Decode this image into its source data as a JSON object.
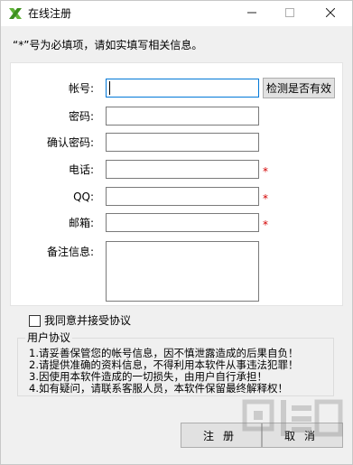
{
  "window": {
    "title": "在线注册",
    "app_icon": "x-logo-icon",
    "controls": [
      "minimize-icon",
      "maximize-icon",
      "close-icon"
    ]
  },
  "notice": "“*”号为必填项，请如实填写相关信息。",
  "form": {
    "account": {
      "label": "帐号:",
      "value": ""
    },
    "check_button": "检测是否有效",
    "password": {
      "label": "密码:",
      "value": ""
    },
    "confirm_password": {
      "label": "确认密码:",
      "value": ""
    },
    "phone": {
      "label": "电话:",
      "value": "",
      "required_mark": "*"
    },
    "qq": {
      "label": "QQ:",
      "value": "",
      "required_mark": "*"
    },
    "email": {
      "label": "邮箱:",
      "value": "",
      "required_mark": "*"
    },
    "remark": {
      "label": "备注信息:",
      "value": ""
    }
  },
  "agree": {
    "label": "我同意并接受协议",
    "checked": false
  },
  "agreement": {
    "title": "用户协议",
    "items": [
      "1.请妥善保管您的帐号信息，因不慎泄露造成的后果自负！",
      "2.请提供准确的资料信息，不得利用本软件从事违法犯罪！",
      "3.因使用本软件造成的一切损失，由用户自行承担！",
      "4.如有疑问，请联系客服人员，本软件保留最终解释权！"
    ]
  },
  "buttons": {
    "register": "注册",
    "cancel": "取消"
  },
  "colors": {
    "required": "#d40000",
    "focus_border": "#0078d7",
    "window_bg": "#f0f0f0"
  }
}
